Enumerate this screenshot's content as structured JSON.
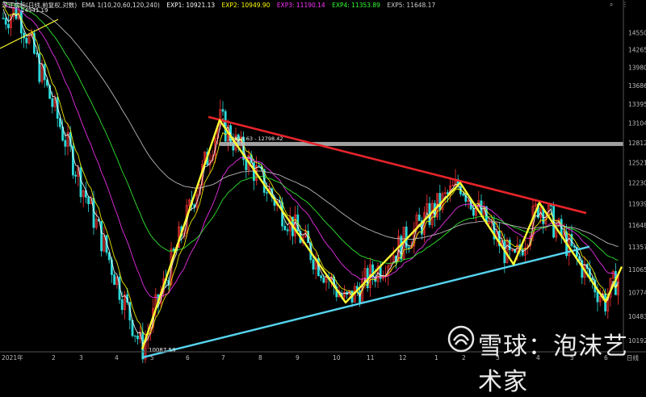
{
  "legend": {
    "title": "深证成指(日线,前复权,对数)",
    "ema": "EMA",
    "ema_params": "1(10,20,60,120,240)",
    "exp1": "EXP1: 10921.13",
    "exp2": "EXP2: 10949.90",
    "exp3": "EXP3: 11190.14",
    "exp4": "EXP4: 11353.89",
    "exp5": "EXP5: 11648.17"
  },
  "colors": {
    "exp1": "#ffffff",
    "exp2": "#ffff00",
    "exp3": "#ff33ff",
    "exp4": "#33ff33",
    "exp5": "#cccccc",
    "trend_up": "#ffff33",
    "resistance": "#e8242a",
    "support": "#55d4f0",
    "candle_up": "#ff3333",
    "candle_down": "#2bd9d9"
  },
  "top_icons": [
    "search-icon",
    "more-icon"
  ],
  "annotations": {
    "high_label": "14941.19",
    "low_label": "10087.53",
    "range_label": "12818.63 - 12798.42"
  },
  "period_label": "日线",
  "watermark": "雪球：泡沫艺术家",
  "chart_data": {
    "type": "candlestick",
    "title": "深证成指(日线,前复权,对数)",
    "log_scale": true,
    "ylim": [
      10000,
      14941.19
    ],
    "y_ticks": [
      14550,
      14265,
      13980,
      13686,
      13395,
      13104,
      12812,
      12521,
      12230,
      11939,
      11648,
      11357,
      11065,
      10774,
      10483,
      10192
    ],
    "x_ticks": [
      "2021年",
      "2",
      "3",
      "4",
      "5",
      "6",
      "7",
      "8",
      "9",
      "10",
      "11",
      "12",
      "1",
      "2",
      "3",
      "4",
      "5",
      "6"
    ],
    "high": 14941.19,
    "low": 10087.53,
    "horizontal_band": [
      12798.42,
      12818.63
    ],
    "wave_pivots": [
      14941.19,
      10087.53,
      13150,
      10650,
      12230,
      11130,
      11950,
      10660,
      11100
    ],
    "support_line": [
      10087.53,
      11360
    ],
    "resistance_line": [
      13150,
      11810
    ],
    "ema_latest": {
      "EXP1": 10921.13,
      "EXP2": 10949.9,
      "EXP3": 11190.14,
      "EXP4": 11353.89,
      "EXP5": 11648.17
    },
    "grid": false
  }
}
